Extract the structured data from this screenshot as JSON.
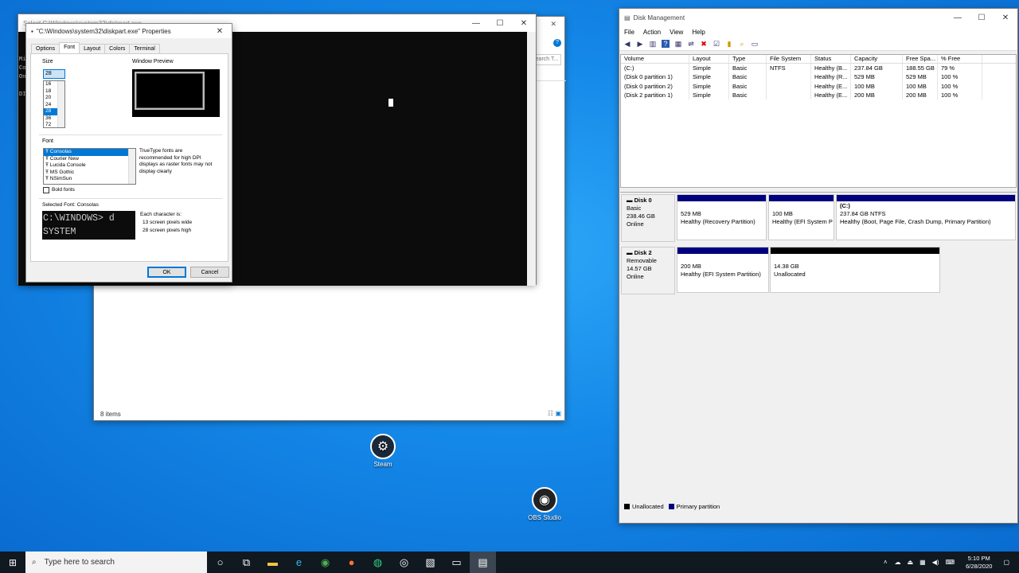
{
  "explorer": {
    "title": "Select C:\\Windows\\system32\\diskpart.exe",
    "search": "Search T...",
    "status": "8 items"
  },
  "cmd": {
    "lines": [
      "Mi",
      "Co",
      "On",
      "",
      "DI"
    ]
  },
  "props": {
    "title": "\"C:\\Windows\\system32\\diskpart.exe\" Properties",
    "tabs": [
      "Options",
      "Font",
      "Layout",
      "Colors",
      "Terminal"
    ],
    "size_label": "Size",
    "size_value": "28",
    "sizes": [
      "16",
      "18",
      "20",
      "24",
      "28",
      "36",
      "72"
    ],
    "window_preview_label": "Window Preview",
    "font_label": "Font",
    "fonts": [
      "Consolas",
      "Courier New",
      "Lucida Console",
      "MS Gothic",
      "NSimSun"
    ],
    "truetype_note": "TrueType fonts are recommended for high DPI displays as raster fonts may not display clearly",
    "bold_label": "Bold fonts",
    "selected_font_label": "Selected Font: Consolas",
    "sample_line1": "C:\\WINDOWS> d",
    "sample_line2": "SYSTEM",
    "each_char": "Each character is:",
    "px_wide": "13 screen pixels wide",
    "px_high": "28 screen pixels high",
    "ok": "OK",
    "cancel": "Cancel"
  },
  "diskmgmt": {
    "title": "Disk Management",
    "menu": [
      "File",
      "Action",
      "View",
      "Help"
    ],
    "columns": [
      "Volume",
      "Layout",
      "Type",
      "File System",
      "Status",
      "Capacity",
      "Free Spa...",
      "% Free"
    ],
    "rows": [
      [
        "(C:)",
        "Simple",
        "Basic",
        "NTFS",
        "Healthy (B...",
        "237.84 GB",
        "188.55 GB",
        "79 %"
      ],
      [
        "(Disk 0 partition 1)",
        "Simple",
        "Basic",
        "",
        "Healthy (R...",
        "529 MB",
        "529 MB",
        "100 %"
      ],
      [
        "(Disk 0 partition 2)",
        "Simple",
        "Basic",
        "",
        "Healthy (E...",
        "100 MB",
        "100 MB",
        "100 %"
      ],
      [
        "(Disk 2 partition 1)",
        "Simple",
        "Basic",
        "",
        "Healthy (E...",
        "200 MB",
        "200 MB",
        "100 %"
      ]
    ],
    "disk0": {
      "name": "Disk 0",
      "type": "Basic",
      "size": "238.46 GB",
      "state": "Online",
      "parts": [
        {
          "l1": "",
          "l2": "529 MB",
          "l3": "Healthy (Recovery Partition)"
        },
        {
          "l1": "",
          "l2": "100 MB",
          "l3": "Healthy (EFI System P"
        },
        {
          "l1": "(C:)",
          "l2": "237.84 GB NTFS",
          "l3": "Healthy (Boot, Page File, Crash Dump, Primary Partition)"
        }
      ]
    },
    "disk2": {
      "name": "Disk 2",
      "type": "Removable",
      "size": "14.57 GB",
      "state": "Online",
      "parts": [
        {
          "l2": "200 MB",
          "l3": "Healthy (EFI System Partition)"
        },
        {
          "l2": "14.38 GB",
          "l3": "Unallocated"
        }
      ]
    },
    "legend": [
      "Unallocated",
      "Primary partition"
    ]
  },
  "desktop": {
    "icons": [
      "Steam",
      "OBS Studio"
    ]
  },
  "taskbar": {
    "search_placeholder": "Type here to search",
    "time": "5:10 PM",
    "date": "6/28/2020"
  },
  "colors": {
    "primary": "#00007f",
    "unallocated": "#000000"
  }
}
